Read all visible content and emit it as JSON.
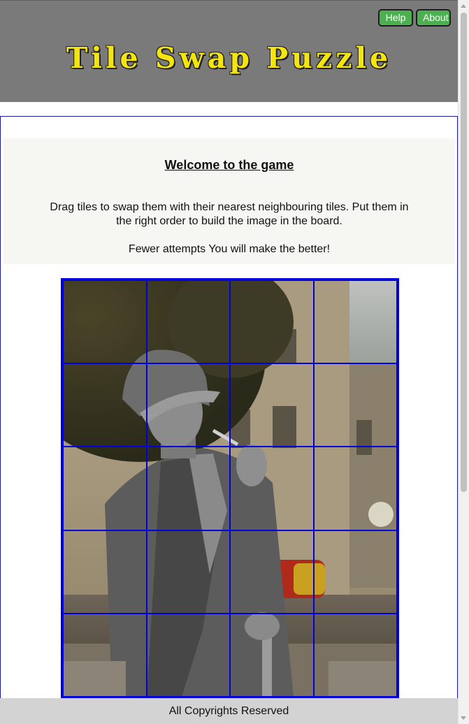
{
  "header": {
    "title": "Tile Swap Puzzle",
    "help_label": "Help",
    "about_label": "About"
  },
  "welcome": {
    "title": "Welcome to the game",
    "text": "Drag tiles to swap them with their nearest neighbouring tiles. Put them in the right order to build the image in the board.",
    "text2": "Fewer attempts You will make the better!"
  },
  "board": {
    "columns": 4,
    "rows": 5,
    "image": "street-performer-photo",
    "border_color": "#0000dd"
  },
  "footer": {
    "text": "All Copyrights Reserved"
  },
  "colors": {
    "header_bg": "#7a7a7a",
    "title_color": "#f4e511",
    "button_bg": "#4caf50",
    "grid_line": "#0000dd"
  }
}
